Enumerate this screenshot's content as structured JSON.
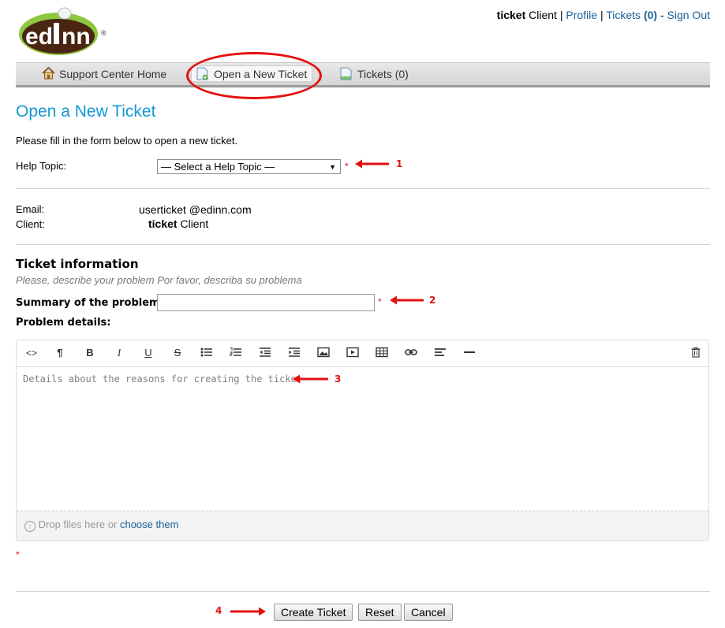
{
  "brand": {
    "logo_text": "edInn",
    "registered": "®"
  },
  "userbar": {
    "username": "ticket",
    "client_word": "Client",
    "sep": "|",
    "profile": "Profile",
    "tickets": "Tickets",
    "tickets_count": "(0)",
    "dash": "-",
    "sign_out": "Sign Out"
  },
  "nav": {
    "items": [
      {
        "label": "Support Center Home",
        "icon": "home-icon",
        "active": false
      },
      {
        "label": "Open a New Ticket",
        "icon": "new-ticket-icon",
        "active": true
      },
      {
        "label": "Tickets (0)",
        "icon": "tickets-icon",
        "active": false
      }
    ]
  },
  "page": {
    "title": "Open a New Ticket",
    "intro": "Please fill in the form below to open a new ticket."
  },
  "form": {
    "help_topic_label": "Help Topic:",
    "help_topic_selected": "— Select a Help Topic —",
    "required_mark": "*",
    "email_label": "Email:",
    "email_value": "userticket @edinn.com",
    "client_label": "Client:",
    "client_name_bold": "ticket",
    "client_name_rest": "Client",
    "section_title": "Ticket information",
    "section_subtitle": "Please, describe your problem Por favor, describa su problema",
    "summary_label": "Summary of the problem:",
    "summary_value": "",
    "details_label": "Problem details:",
    "details_placeholder": "Details about the reasons for creating the ticket",
    "drop_text": "Drop files here or",
    "drop_link": "choose them"
  },
  "toolbar": {
    "buttons": [
      {
        "name": "html-icon",
        "glyph": "<>"
      },
      {
        "name": "paragraph-icon",
        "glyph": "¶"
      },
      {
        "name": "bold-icon",
        "glyph": "B"
      },
      {
        "name": "italic-icon",
        "glyph": "I"
      },
      {
        "name": "underline-icon",
        "glyph": "U"
      },
      {
        "name": "strikethrough-icon",
        "glyph": "S"
      }
    ]
  },
  "annotations": {
    "n1": "1",
    "n2": "2",
    "n3": "3",
    "n4": "4"
  },
  "buttons": {
    "create": "Create Ticket",
    "reset": "Reset",
    "cancel": "Cancel"
  },
  "colors": {
    "accent_title": "#1299d6",
    "link": "#1a5f96",
    "annotation_red": "#e3100f"
  }
}
